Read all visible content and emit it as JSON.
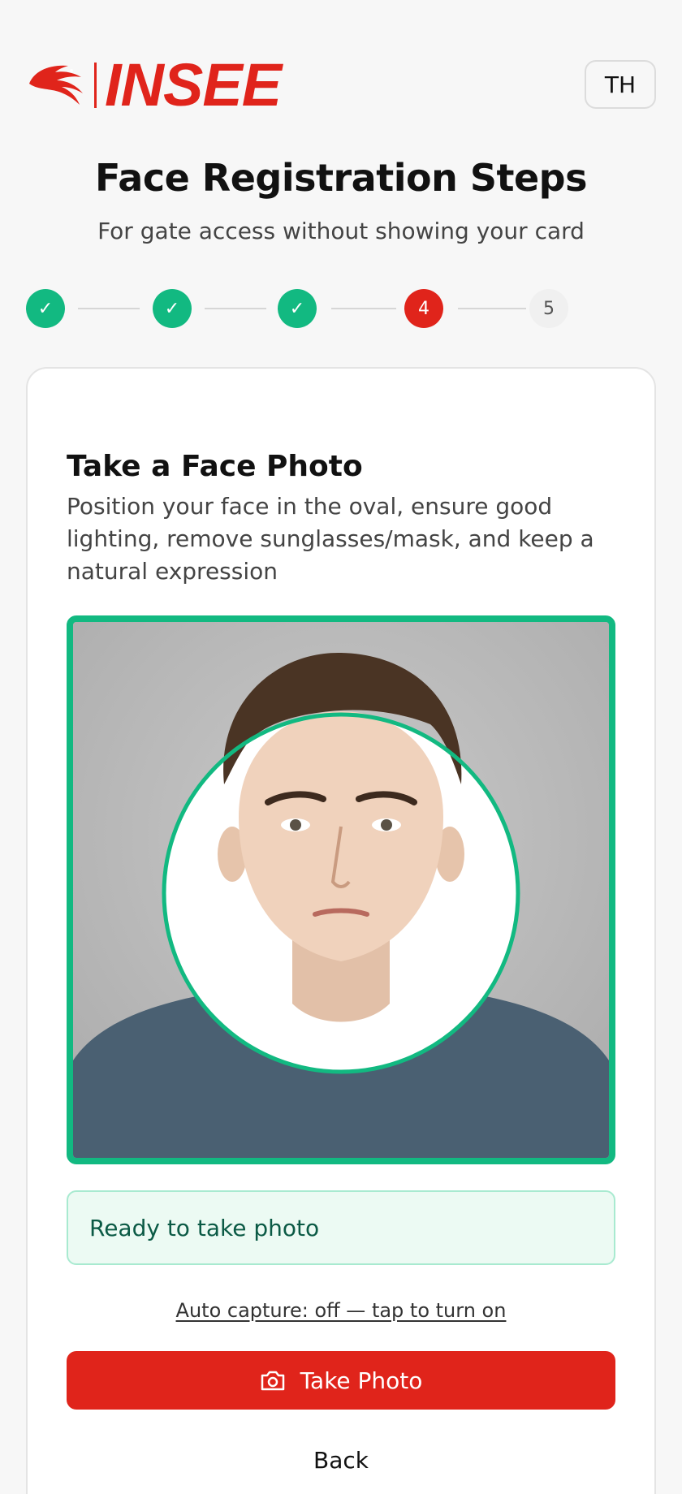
{
  "brand": {
    "logo_text": "INSEE",
    "accent_color": "#e0241b"
  },
  "header": {
    "lang_button": "TH"
  },
  "title": "Face Registration Steps",
  "subtitle": "For gate access without showing your card",
  "stepper": {
    "steps": [
      {
        "label": "✓",
        "state": "done"
      },
      {
        "label": "✓",
        "state": "done"
      },
      {
        "label": "✓",
        "state": "done"
      },
      {
        "label": "4",
        "state": "active"
      },
      {
        "label": "5",
        "state": "todo"
      }
    ],
    "done_color": "#12b981",
    "active_color": "#e0241b"
  },
  "card": {
    "title": "Take a Face Photo",
    "description": "Position your face in the oval, ensure good lighting, remove sunglasses/mask, and keep a natural expression",
    "status": "Ready to take photo",
    "auto_capture": "Auto capture: off — tap to turn on",
    "take_photo_label": "Take Photo",
    "take_photo_icon": "camera-icon",
    "back_label": "Back"
  }
}
